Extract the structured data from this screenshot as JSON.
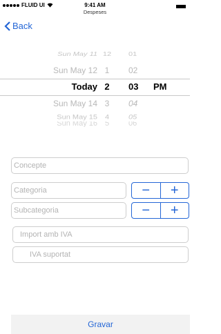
{
  "status": {
    "carrier": "FLUID UI",
    "time": "9:41 AM",
    "screen_title": "Despeses"
  },
  "nav": {
    "back_label": "Back"
  },
  "picker": {
    "rows": [
      {
        "date": "Sun May 11",
        "hour": "12",
        "minute": "01",
        "ampm": ""
      },
      {
        "date": "Sun May 12",
        "hour": "1",
        "minute": "02",
        "ampm": ""
      },
      {
        "date": "Today",
        "hour": "2",
        "minute": "03",
        "ampm": "PM"
      },
      {
        "date": "Sun May 14",
        "hour": "3",
        "minute": "04",
        "ampm": ""
      },
      {
        "date": "Sun May 15",
        "hour": "4",
        "minute": "05",
        "ampm": ""
      },
      {
        "date": "Sun May 16",
        "hour": "5",
        "minute": "06",
        "ampm": ""
      }
    ]
  },
  "form": {
    "concepte_placeholder": "Concepte",
    "categoria_placeholder": "Categoria",
    "subcategoria_placeholder": "Subcategoria",
    "import_placeholder": "Import amb IVA",
    "iva_placeholder": "IVA suportat",
    "stepper_minus": "−",
    "stepper_plus": "+"
  },
  "footer": {
    "save_label": "Gravar"
  },
  "colors": {
    "accent": "#2466d6",
    "border": "#cdcdcd",
    "footer_bg": "#f2f2f2"
  }
}
